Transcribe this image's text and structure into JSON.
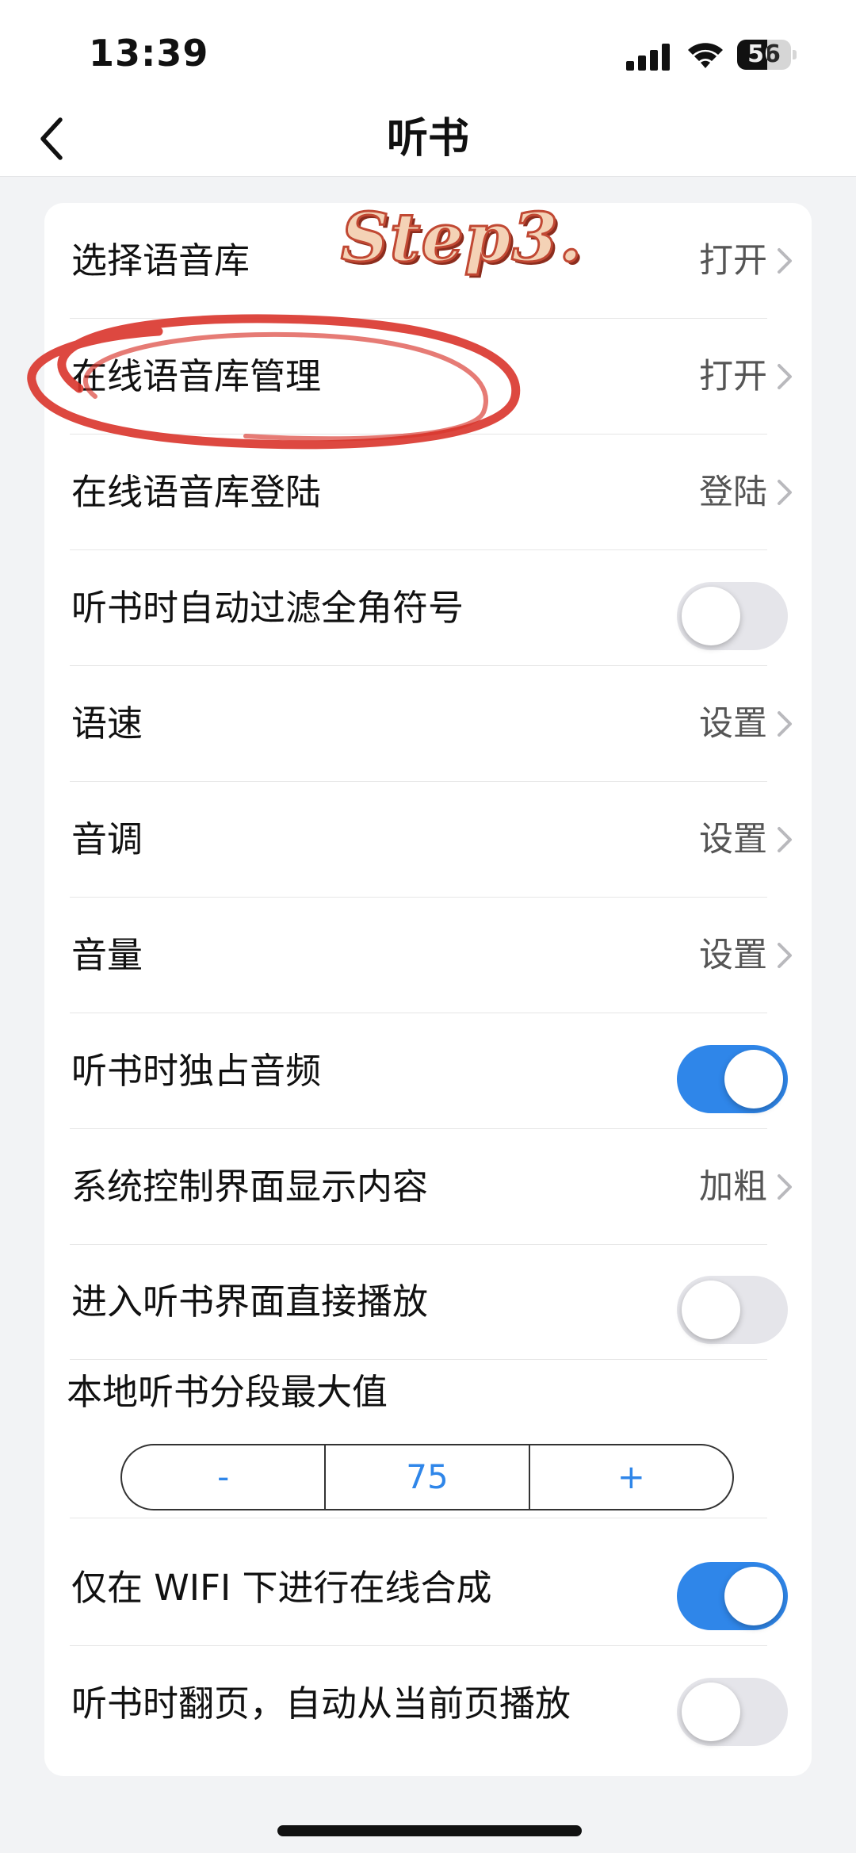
{
  "status_bar": {
    "time": "13:39",
    "battery_level": "56"
  },
  "nav": {
    "title": "听书",
    "back_icon": "chevron-left-icon"
  },
  "settings": {
    "rows": [
      {
        "label": "选择语音库",
        "value": "打开",
        "type": "link"
      },
      {
        "label": "在线语音库管理",
        "value": "打开",
        "type": "link"
      },
      {
        "label": "在线语音库登陆",
        "value": "登陆",
        "type": "link"
      },
      {
        "label": "听书时自动过滤全角符号",
        "type": "toggle",
        "on": false
      },
      {
        "label": "语速",
        "value": "设置",
        "type": "link"
      },
      {
        "label": "音调",
        "value": "设置",
        "type": "link"
      },
      {
        "label": "音量",
        "value": "设置",
        "type": "link"
      },
      {
        "label": "听书时独占音频",
        "type": "toggle",
        "on": true
      },
      {
        "label": "系统控制界面显示内容",
        "value": "加粗",
        "type": "link"
      },
      {
        "label": "进入听书界面直接播放",
        "type": "toggle",
        "on": false
      }
    ],
    "stepper": {
      "title": "本地听书分段最大值",
      "minus": "-",
      "value": "75",
      "plus": "+"
    },
    "bottom_rows": [
      {
        "label": "仅在 WIFI 下进行在线合成",
        "type": "toggle",
        "on": true
      },
      {
        "label": "听书时翻页，自动从当前页播放",
        "type": "toggle",
        "on": false
      }
    ]
  },
  "annotation": {
    "step_text": "Step3.",
    "highlight_color": "#d9342b"
  },
  "colors": {
    "accent": "#2f86e9",
    "background": "#f2f3f5"
  }
}
